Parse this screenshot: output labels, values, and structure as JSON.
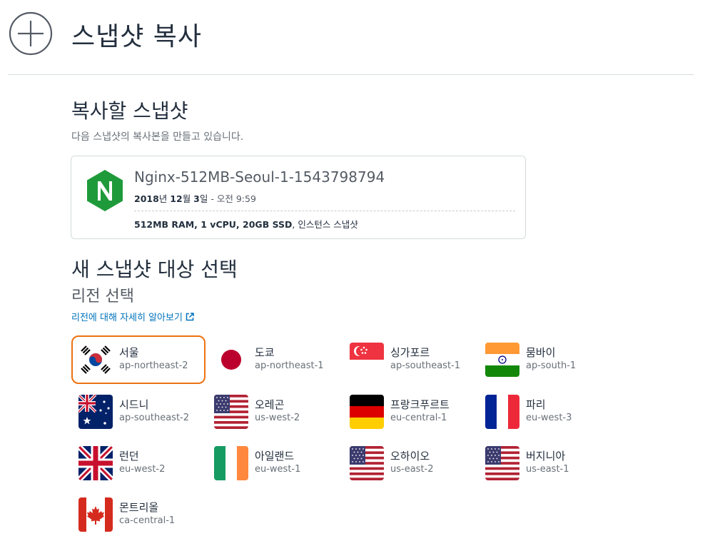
{
  "header": {
    "title": "스냅샷 복사"
  },
  "source": {
    "title": "복사할 스냅샷",
    "subtitle": "다음 스냅샷의 복사본을 만들고 있습니다.",
    "snapshot": {
      "name": "Nginx-512MB-Seoul-1-1543798794",
      "date_bold": "2018",
      "date_text1": "년 ",
      "date_bold2": "12",
      "date_text2": "월 ",
      "date_bold3": "3",
      "date_text3": "일",
      "time": " - 오전 9:59",
      "specs_bold": "512MB RAM, 1 vCPU, 20GB SSD",
      "specs_text": ", 인스턴스 스냅샷",
      "logo_letter": "N"
    }
  },
  "target": {
    "title": "새 스냅샷 대상 선택",
    "region_heading": "리전 선택",
    "learn_link": "리전에 대해 자세히 알아보기",
    "accent": "#ec7211",
    "link_color": "#0073bb",
    "regions": [
      {
        "name": "서울",
        "code": "ap-northeast-2",
        "flag": "kr",
        "selected": true
      },
      {
        "name": "도쿄",
        "code": "ap-northeast-1",
        "flag": "jp"
      },
      {
        "name": "싱가포르",
        "code": "ap-southeast-1",
        "flag": "sg"
      },
      {
        "name": "뭄바이",
        "code": "ap-south-1",
        "flag": "in"
      },
      {
        "name": "시드니",
        "code": "ap-southeast-2",
        "flag": "au"
      },
      {
        "name": "오레곤",
        "code": "us-west-2",
        "flag": "us"
      },
      {
        "name": "프랑크푸르트",
        "code": "eu-central-1",
        "flag": "de"
      },
      {
        "name": "파리",
        "code": "eu-west-3",
        "flag": "fr"
      },
      {
        "name": "런던",
        "code": "eu-west-2",
        "flag": "gb"
      },
      {
        "name": "아일랜드",
        "code": "eu-west-1",
        "flag": "ie"
      },
      {
        "name": "오하이오",
        "code": "us-east-2",
        "flag": "us"
      },
      {
        "name": "버지니아",
        "code": "us-east-1",
        "flag": "us"
      },
      {
        "name": "몬트리올",
        "code": "ca-central-1",
        "flag": "ca"
      }
    ]
  }
}
